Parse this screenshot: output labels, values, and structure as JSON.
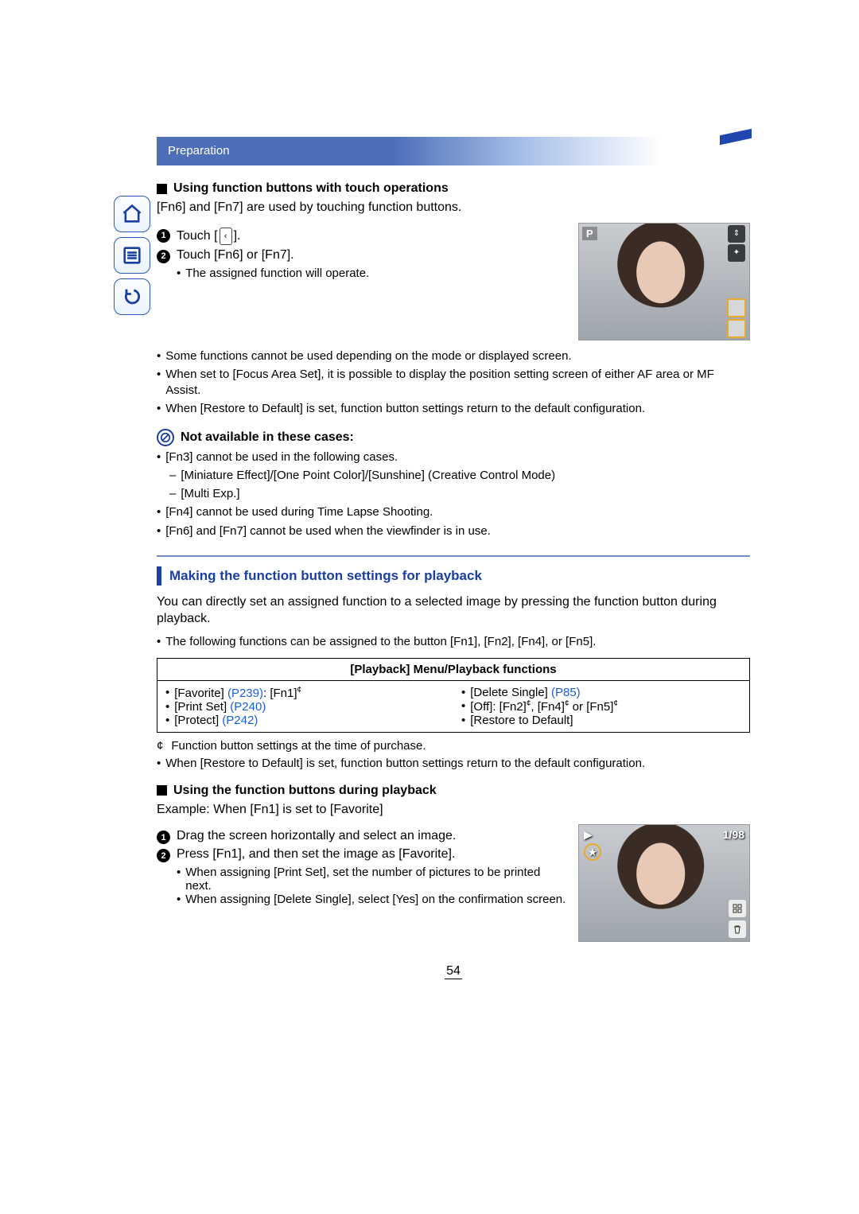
{
  "breadcrumb": "Preparation",
  "pageNumber": "54",
  "nav": {
    "home": "home-icon",
    "contents": "contents-icon",
    "back": "back-icon"
  },
  "s1": {
    "heading": "Using function buttons with touch operations",
    "intro": "[Fn6] and [Fn7] are used by touching function buttons.",
    "step1a": "Touch [",
    "step1b": "].",
    "step2": "Touch [Fn6] or [Fn7].",
    "step2_sub": "The assigned function will operate.",
    "thumbP": "P"
  },
  "notes1": {
    "b1": "Some functions cannot be used depending on the mode or displayed screen.",
    "b2": "When set to [Focus Area Set], it is possible to display the position setting screen of either AF area or MF Assist.",
    "b3": "When [Restore to Default] is set, function button settings return to the default configuration."
  },
  "na": {
    "title": "Not available in these cases:",
    "b1": "[Fn3] cannot be used in the following cases.",
    "b1a": "[Miniature Effect]/[One Point Color]/[Sunshine] (Creative Control Mode)",
    "b1b": "[Multi Exp.]",
    "b2": "[Fn4] cannot be used during Time Lapse Shooting.",
    "b3": "[Fn6] and [Fn7] cannot be used when the viewfinder is in use."
  },
  "s2": {
    "heading": "Making the function button settings for playback",
    "intro": "You can directly set an assigned function to a selected image by pressing the function button during playback.",
    "sub": "The following functions can be assigned to the button [Fn1], [Fn2], [Fn4], or [Fn5]."
  },
  "table": {
    "header": "[Playback] Menu/Playback functions",
    "l1a": "[Favorite] ",
    "l1_link": "(P239)",
    "l1b": ": [Fn1]",
    "l2a": "[Print Set] ",
    "l2_link": "(P240)",
    "l3a": "[Protect] ",
    "l3_link": "(P242)",
    "r1a": "[Delete Single] ",
    "r1_link": "(P85)",
    "r2a": "[Off]: [Fn2]",
    "r2b": ", [Fn4]",
    "r2c": " or [Fn5]",
    "r3": "[Restore to Default]"
  },
  "foot": {
    "star": "¢",
    "f1": "Function button settings at the time of purchase.",
    "f2": "When [Restore to Default] is set, function button settings return to the default configuration."
  },
  "s3": {
    "heading": "Using the function buttons during playback",
    "example": "Example: When [Fn1] is set to [Favorite]",
    "step1": "Drag the screen horizontally and select an image.",
    "step2": "Press [Fn1], and then set the image as [Favorite].",
    "step2_sub1": "When assigning [Print Set], set the number of pictures to be printed next.",
    "step2_sub2": "When assigning [Delete Single], select [Yes] on the confirmation screen.",
    "counter": "1/98"
  }
}
